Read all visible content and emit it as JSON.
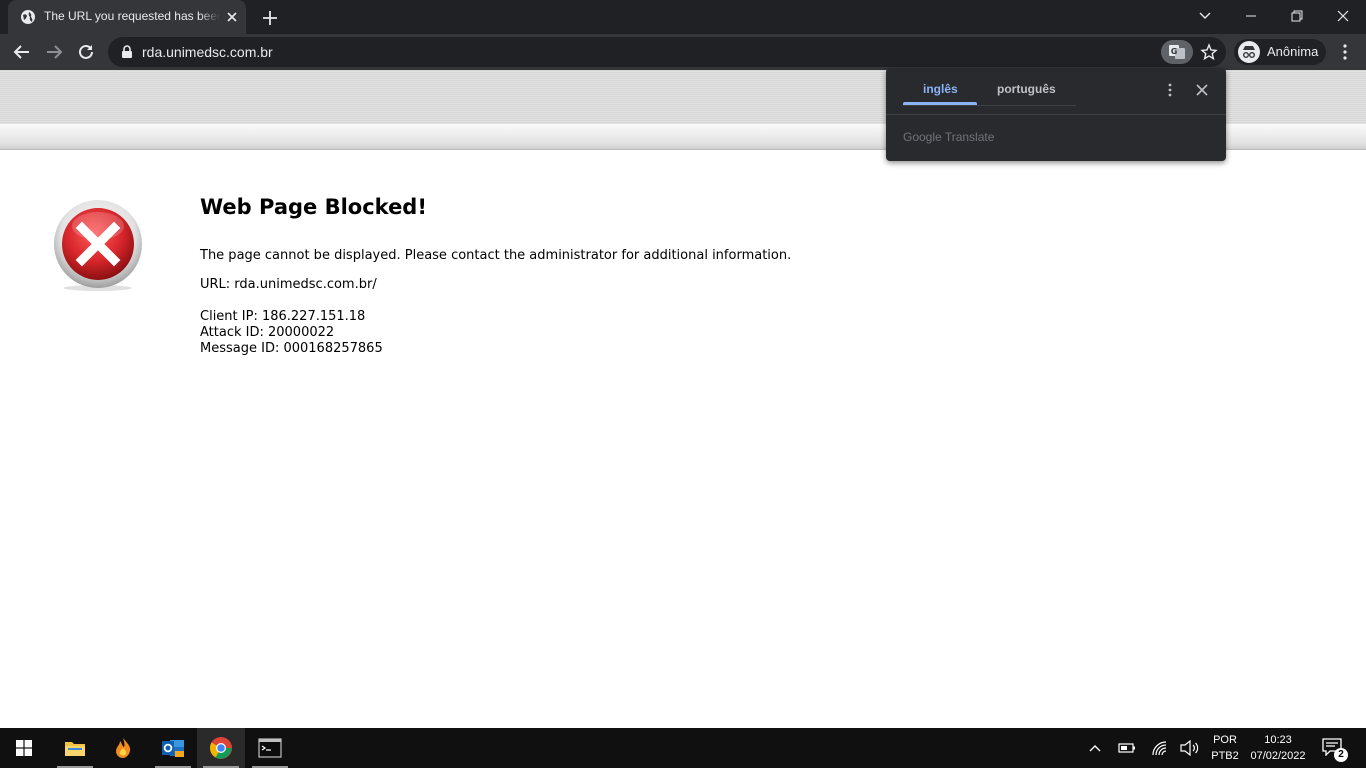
{
  "browser": {
    "tab": {
      "title": "The URL you requested has been blocked",
      "favicon": "globe-icon"
    },
    "address": {
      "url": "rda.unimedsc.com.br"
    },
    "profile": {
      "label": "Anônima",
      "icon": "incognito-icon"
    }
  },
  "page": {
    "title": "Web Page Blocked!",
    "message": "The page cannot be displayed. Please contact the administrator for additional information.",
    "url_line": "URL: rda.unimedsc.com.br/",
    "client_ip": "Client IP: 186.227.151.18",
    "attack_id": "Attack ID: 20000022",
    "message_id": "Message ID: 000168257865",
    "icon": "error-x-icon"
  },
  "translate_popup": {
    "source_lang": "inglês",
    "target_lang": "português",
    "footer": "Google Translate"
  },
  "taskbar": {
    "apps": [
      "windows-start-icon",
      "file-explorer-icon",
      "firefox-like-icon",
      "outlook-icon",
      "chrome-icon",
      "terminal-icon"
    ],
    "lang_top": "POR",
    "lang_bottom": "PTB2",
    "time": "10:23",
    "date": "07/02/2022",
    "notification_count": "2"
  },
  "colors": {
    "chrome_dark": "#202124",
    "chrome_toolbar": "#35363a",
    "accent_blue": "#8ab4f8",
    "error_red": "#d6262b"
  }
}
